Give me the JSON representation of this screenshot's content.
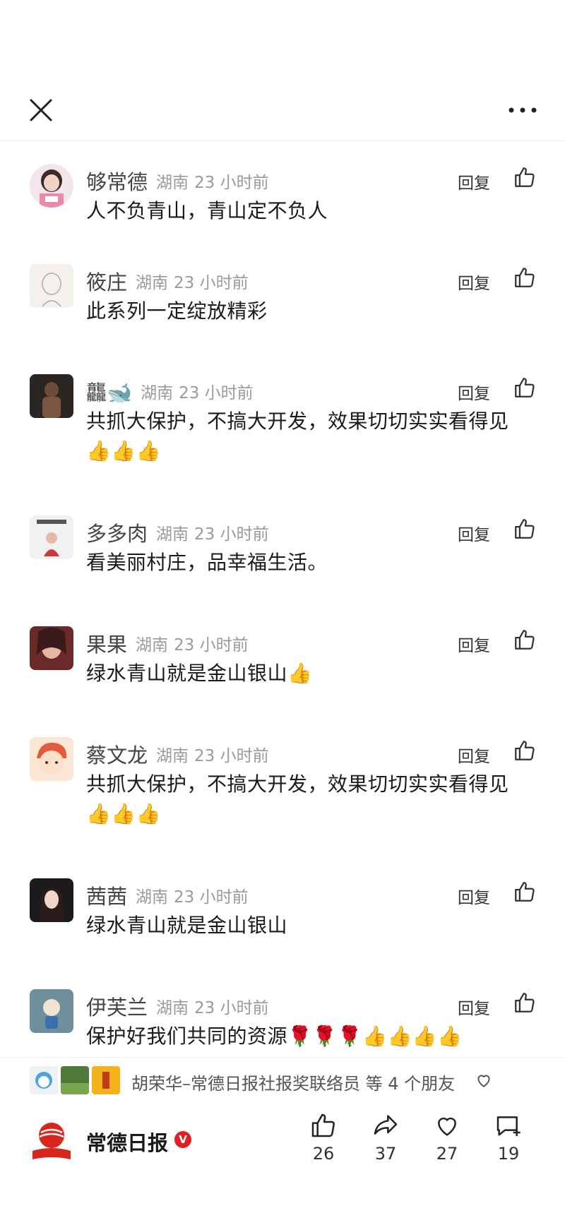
{
  "topbar": {
    "close_icon": "close-icon",
    "more_icon": "more-icon"
  },
  "comments": [
    {
      "user": "够常德",
      "region": "湖南",
      "time": "23 小时前",
      "reply": "回复",
      "text": "人不负青山，青山定不负人"
    },
    {
      "user": "筱庄",
      "region": "湖南",
      "time": "23 小时前",
      "reply": "回复",
      "text": "此系列一定绽放精彩"
    },
    {
      "user": "龘🐋",
      "region": "湖南",
      "time": "23 小时前",
      "reply": "回复",
      "text": "共抓大保护，不搞大开发，效果切切实实看得见👍👍👍"
    },
    {
      "user": "多多肉",
      "region": "湖南",
      "time": "23 小时前",
      "reply": "回复",
      "text": "看美丽村庄，品幸福生活。"
    },
    {
      "user": "果果",
      "region": "湖南",
      "time": "23 小时前",
      "reply": "回复",
      "text": "绿水青山就是金山银山👍"
    },
    {
      "user": "蔡文龙",
      "region": "湖南",
      "time": "23 小时前",
      "reply": "回复",
      "text": "共抓大保护，不搞大开发，效果切切实实看得见👍👍👍"
    },
    {
      "user": "茜茜",
      "region": "湖南",
      "time": "23 小时前",
      "reply": "回复",
      "text": "绿水青山就是金山银山"
    },
    {
      "user": "伊芙兰",
      "region": "湖南",
      "time": "23 小时前",
      "reply": "回复",
      "text": "保护好我们共同的资源🌹🌹🌹👍👍👍👍"
    }
  ],
  "friends_bar": {
    "text": "胡荣华–常德日报社报奖联络员 等 4 个朋友",
    "heart_icon": "heart-outline-icon"
  },
  "bottom_bar": {
    "publisher": "常德日报",
    "verified": "V",
    "actions": [
      {
        "icon": "thumbs-up-icon",
        "count": "26"
      },
      {
        "icon": "share-icon",
        "count": "37"
      },
      {
        "icon": "heart-icon",
        "count": "27"
      },
      {
        "icon": "comment-plus-icon",
        "count": "19"
      }
    ]
  },
  "colors": {
    "brand_red": "#d9251d",
    "secondary_text": "#9a9a9a"
  }
}
